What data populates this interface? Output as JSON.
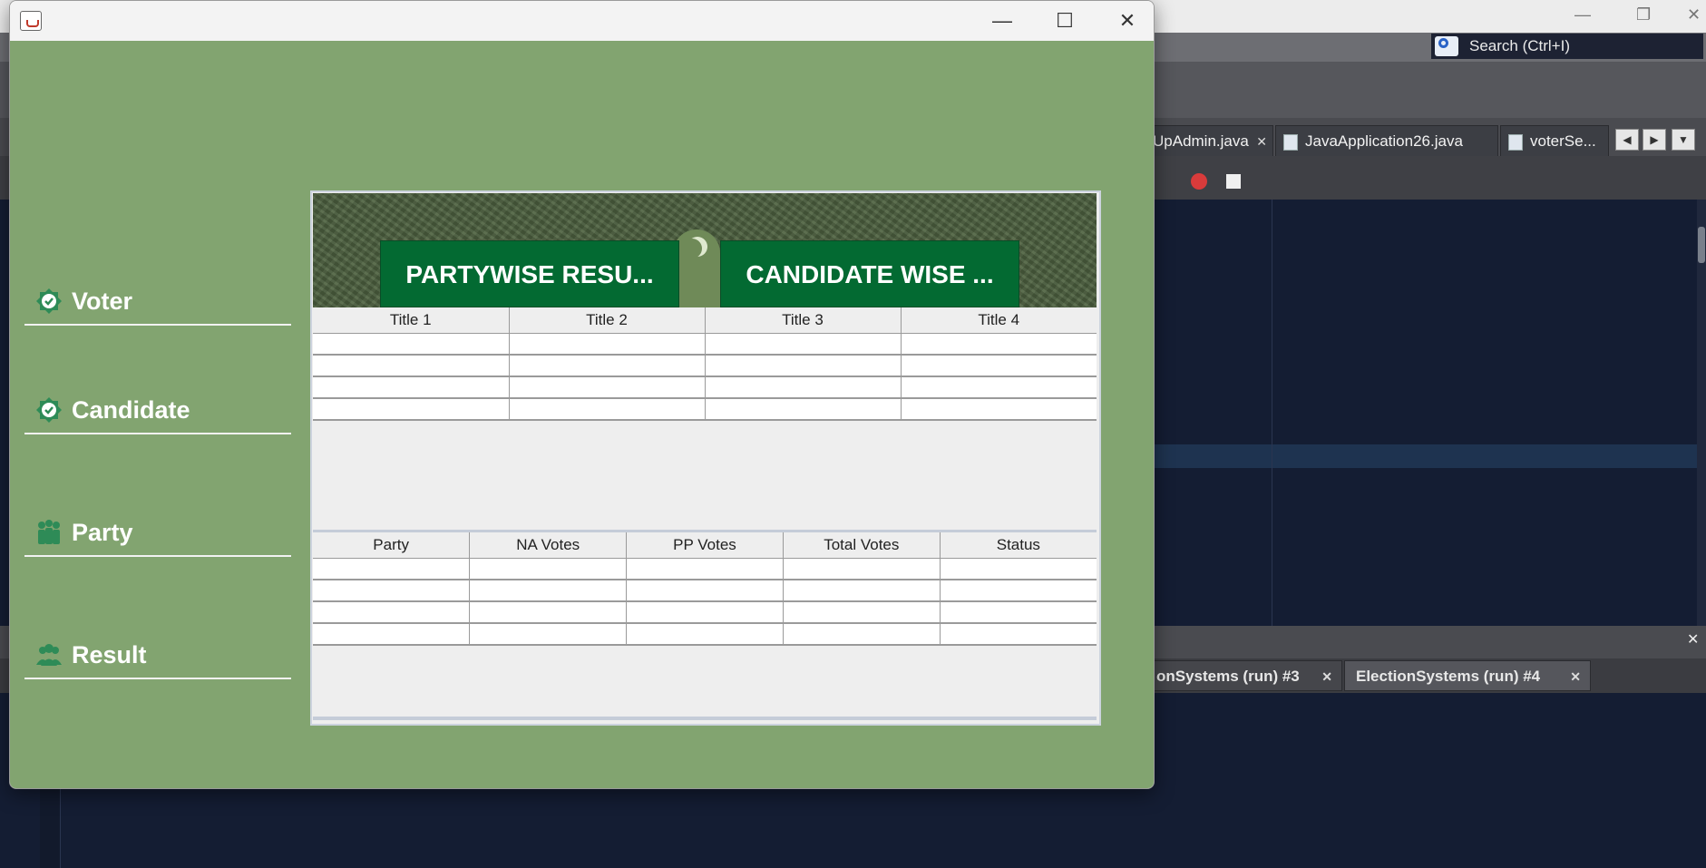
{
  "ide": {
    "search_placeholder": "Search (Ctrl+I)",
    "editor_tabs": [
      {
        "label": "UpAdmin.java"
      },
      {
        "label": "JavaApplication26.java"
      },
      {
        "label": "voterSe..."
      }
    ],
    "output_tabs": [
      {
        "label": "onSystems (run) #3"
      },
      {
        "label": "ElectionSystems (run) #4"
      }
    ]
  },
  "window": {
    "title": "",
    "menu": [
      {
        "label": "Voter",
        "icon": "check-badge-icon"
      },
      {
        "label": "Candidate",
        "icon": "check-badge-icon"
      },
      {
        "label": "Party",
        "icon": "group-icon"
      },
      {
        "label": "Result",
        "icon": "users-icon"
      }
    ],
    "banner_buttons": [
      {
        "label": "PARTYWISE RESU..."
      },
      {
        "label": "CANDIDATE WISE ..."
      }
    ],
    "table1": {
      "headers": [
        "Title 1",
        "Title 2",
        "Title 3",
        "Title 4"
      ],
      "rows": [
        [
          "",
          "",
          "",
          ""
        ],
        [
          "",
          "",
          "",
          ""
        ],
        [
          "",
          "",
          "",
          ""
        ],
        [
          "",
          "",
          "",
          ""
        ]
      ]
    },
    "table2": {
      "headers": [
        "Party",
        "NA Votes",
        "PP Votes",
        "Total Votes",
        "Status"
      ],
      "rows": [
        [
          "",
          "",
          "",
          "",
          ""
        ],
        [
          "",
          "",
          "",
          "",
          ""
        ],
        [
          "",
          "",
          "",
          "",
          ""
        ],
        [
          "",
          "",
          "",
          "",
          ""
        ]
      ]
    }
  },
  "colors": {
    "window_bg": "#82a470",
    "banner_button": "#036a32",
    "ide_editor": "#141d33"
  }
}
